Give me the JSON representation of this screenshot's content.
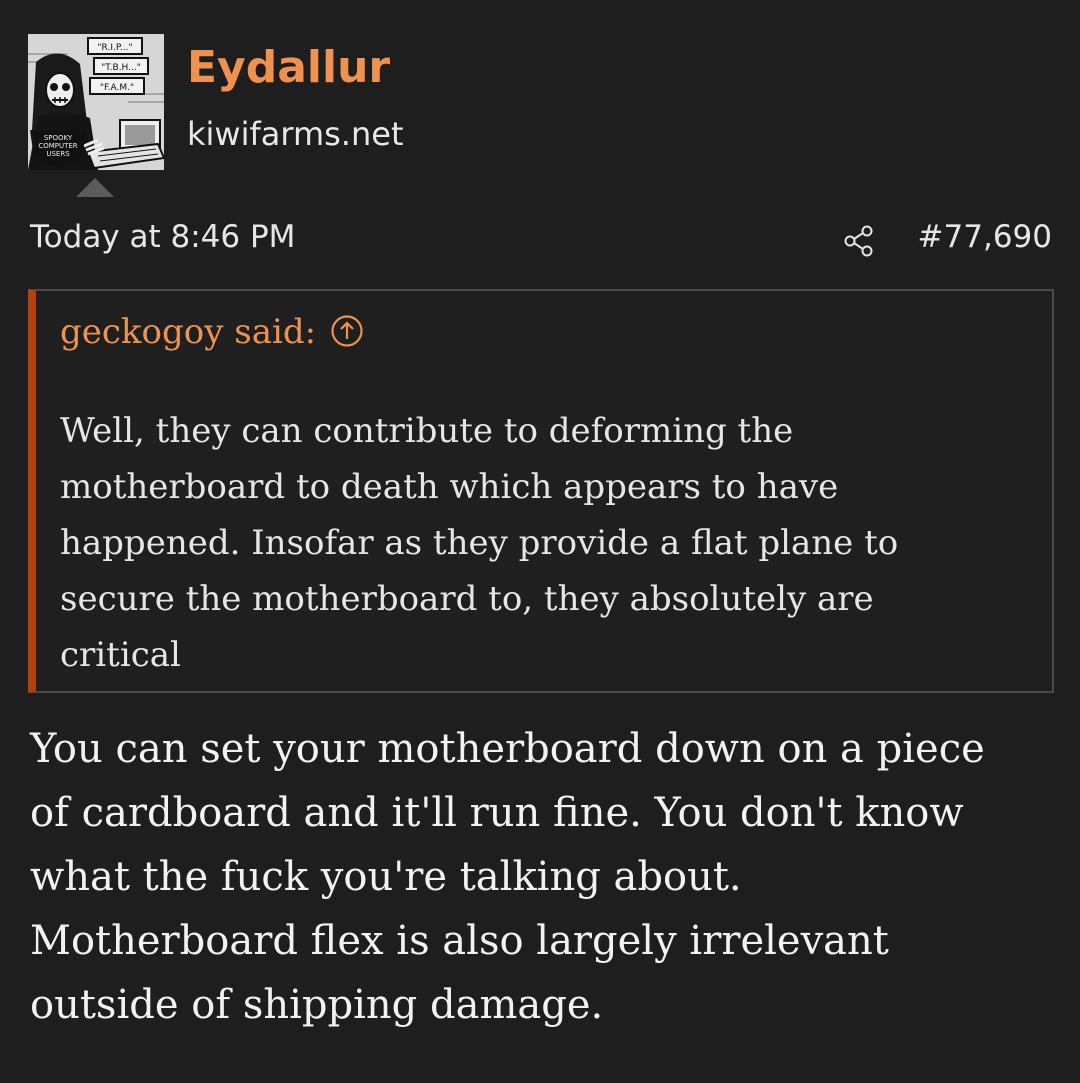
{
  "post": {
    "author": {
      "username": "Eydallur",
      "user_title": "kiwifarms.net",
      "avatar": {
        "icon": "spooky-computer-users-avatar",
        "sign_lines": [
          "\"R.I.P...\"",
          "\"T.B.H...\"",
          "\"F.A.M.\""
        ],
        "caption_lines": [
          "SPOOKY",
          "COMPUTER",
          "USERS"
        ]
      }
    },
    "meta": {
      "date": "Today at 8:46 PM",
      "share_icon": "share-icon",
      "post_number": "#77,690"
    },
    "quote": {
      "attribution": "geckogoy said:",
      "jump_icon": "arrow-up-circle-icon",
      "lines": [
        "Well, they can contribute to deforming the",
        "motherboard to death which appears to have",
        "happened. Insofar as they provide a flat plane to",
        "secure the motherboard to, they absolutely are",
        "critical"
      ]
    },
    "reply": {
      "lines": [
        "You can set your motherboard down on a piece",
        "of cardboard and it'll run fine. You don't know",
        "what the fuck you're talking about.",
        "Motherboard flex is also largely irrelevant",
        "outside of shipping damage."
      ]
    },
    "colors": {
      "background": "#1e1e1e",
      "username": "#f0924f",
      "quote_accent": "#b5400f",
      "quote_border": "#4a4a4a",
      "text": "#eaeaea"
    }
  }
}
